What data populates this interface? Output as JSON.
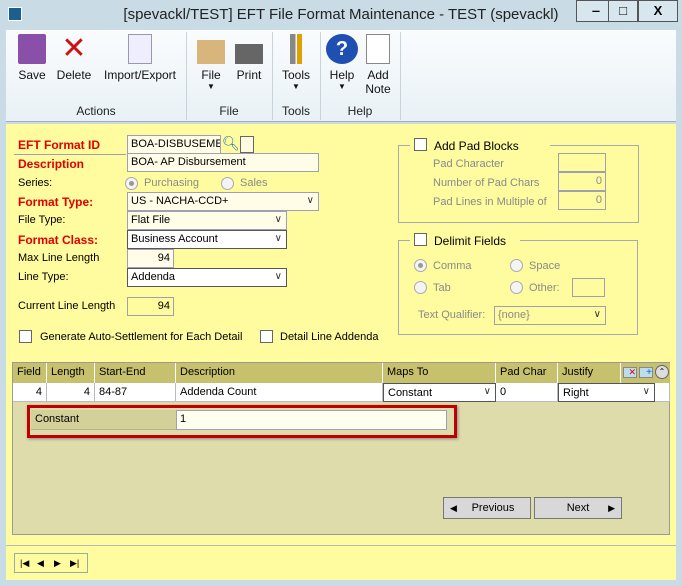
{
  "window": {
    "title": "[spevackl/TEST] EFT File Format Maintenance  -  TEST (spevackl)",
    "minimize": "‒",
    "maximize": "□",
    "close": "X"
  },
  "toolbar": {
    "save": "Save",
    "delete": "Delete",
    "import_export": "Import/Export",
    "file": "File",
    "print": "Print",
    "tools": "Tools",
    "help": "Help",
    "add_note_1": "Add",
    "add_note_2": "Note",
    "groups": {
      "actions": "Actions",
      "file": "File",
      "tools": "Tools",
      "help": "Help"
    }
  },
  "form": {
    "eft_format_id_label": "EFT Format ID",
    "eft_format_id": "BOA-DISBUSEME",
    "description_label": "Description",
    "description": "BOA- AP Disbursement",
    "series_label": "Series:",
    "series_options": [
      "Purchasing",
      "Sales"
    ],
    "series_selected": "Purchasing",
    "format_type_label": "Format Type:",
    "format_type": "US - NACHA-CCD+",
    "file_type_label": "File Type:",
    "file_type": "Flat File",
    "format_class_label": "Format Class:",
    "format_class": "Business Account",
    "max_line_length_label": "Max Line Length",
    "max_line_length": "94",
    "line_type_label": "Line Type:",
    "line_type": "Addenda",
    "current_line_length_label": "Current Line Length",
    "current_line_length": "94",
    "auto_settlement_label": "Generate Auto-Settlement for Each Detail",
    "auto_settlement_checked": false,
    "detail_line_addenda_label": "Detail Line Addenda",
    "detail_line_addenda_checked": false
  },
  "pad_blocks": {
    "label": "Add Pad Blocks",
    "checked": false,
    "pad_character_label": "Pad Character",
    "pad_character": "",
    "num_pad_chars_label": "Number of Pad Chars",
    "num_pad_chars": "0",
    "pad_lines_label": "Pad Lines in Multiple of",
    "pad_lines": "0"
  },
  "delimit": {
    "label": "Delimit Fields",
    "checked": false,
    "comma": "Comma",
    "space": "Space",
    "tab": "Tab",
    "other": "Other:",
    "other_value": "",
    "selected": "Comma",
    "text_qualifier_label": "Text Qualifier:",
    "text_qualifier": "{none}"
  },
  "grid": {
    "columns": [
      "Field",
      "Length",
      "Start-End",
      "Description",
      "Maps To",
      "Pad Char",
      "Justify"
    ],
    "row": {
      "field": "4",
      "length": "4",
      "start_end": "84-87",
      "description": "Addenda Count",
      "maps_to": "Constant",
      "pad_char": "0",
      "justify": "Right"
    },
    "detail": {
      "constant_label": "Constant",
      "constant_value": "1"
    },
    "previous": "Previous",
    "next": "Next"
  },
  "highlight_color": "#c00000"
}
